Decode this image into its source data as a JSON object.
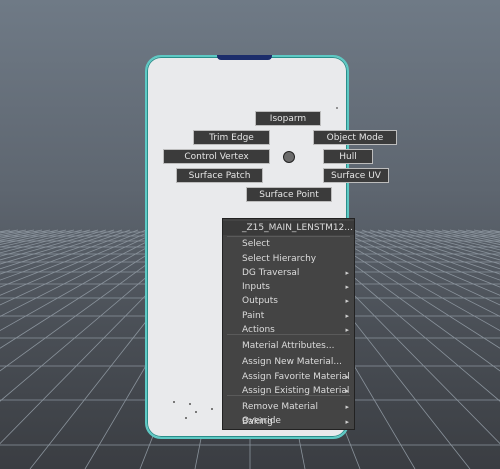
{
  "marking_menu": {
    "isoparm": "Isoparm",
    "trim_edge": "Trim Edge",
    "object_mode": "Object Mode",
    "control_vertex": "Control Vertex",
    "hull": "Hull",
    "surface_patch": "Surface Patch",
    "surface_uv": "Surface UV",
    "surface_point": "Surface Point"
  },
  "context_menu": {
    "header": "_Z15_MAIN_LENSTM12...",
    "items": [
      {
        "label": "Select",
        "submenu": false
      },
      {
        "label": "Select Hierarchy",
        "submenu": false
      },
      {
        "label": "DG Traversal",
        "submenu": true
      },
      {
        "label": "Inputs",
        "submenu": true
      },
      {
        "label": "Outputs",
        "submenu": true
      },
      {
        "label": "Paint",
        "submenu": true
      },
      {
        "label": "Actions",
        "submenu": true
      },
      {
        "label": "Material Attributes...",
        "submenu": false
      },
      {
        "label": "Assign New Material...",
        "submenu": false
      },
      {
        "label": "Assign Favorite Material",
        "submenu": true
      },
      {
        "label": "Assign Existing Material",
        "submenu": true
      },
      {
        "label": "Remove Material Override",
        "submenu": true
      },
      {
        "label": "Baking",
        "submenu": true
      }
    ],
    "submenu_arrow": "▸"
  },
  "colors": {
    "model_outline": "#5ec9c4",
    "menu_bg": "#444444",
    "grid": "#8a939c"
  }
}
